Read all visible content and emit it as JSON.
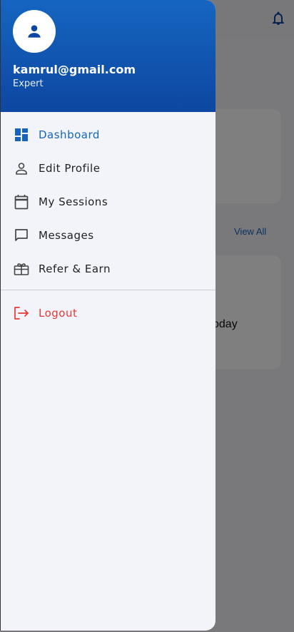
{
  "background": {
    "view_all_label": "View All",
    "partial_text": "oday"
  },
  "drawer": {
    "user": {
      "email": "kamrul@gmail.com",
      "role": "Expert"
    },
    "menu": [
      {
        "label": "Dashboard",
        "icon": "dashboard-icon",
        "active": true
      },
      {
        "label": "Edit Profile",
        "icon": "person-icon"
      },
      {
        "label": "My Sessions",
        "icon": "calendar-icon"
      },
      {
        "label": "Messages",
        "icon": "message-icon"
      },
      {
        "label": "Refer & Earn",
        "icon": "gift-icon"
      }
    ],
    "logout_label": "Logout"
  },
  "colors": {
    "primary": "#1565c0",
    "header_dark": "#0d47a1",
    "logout": "#e53935"
  }
}
